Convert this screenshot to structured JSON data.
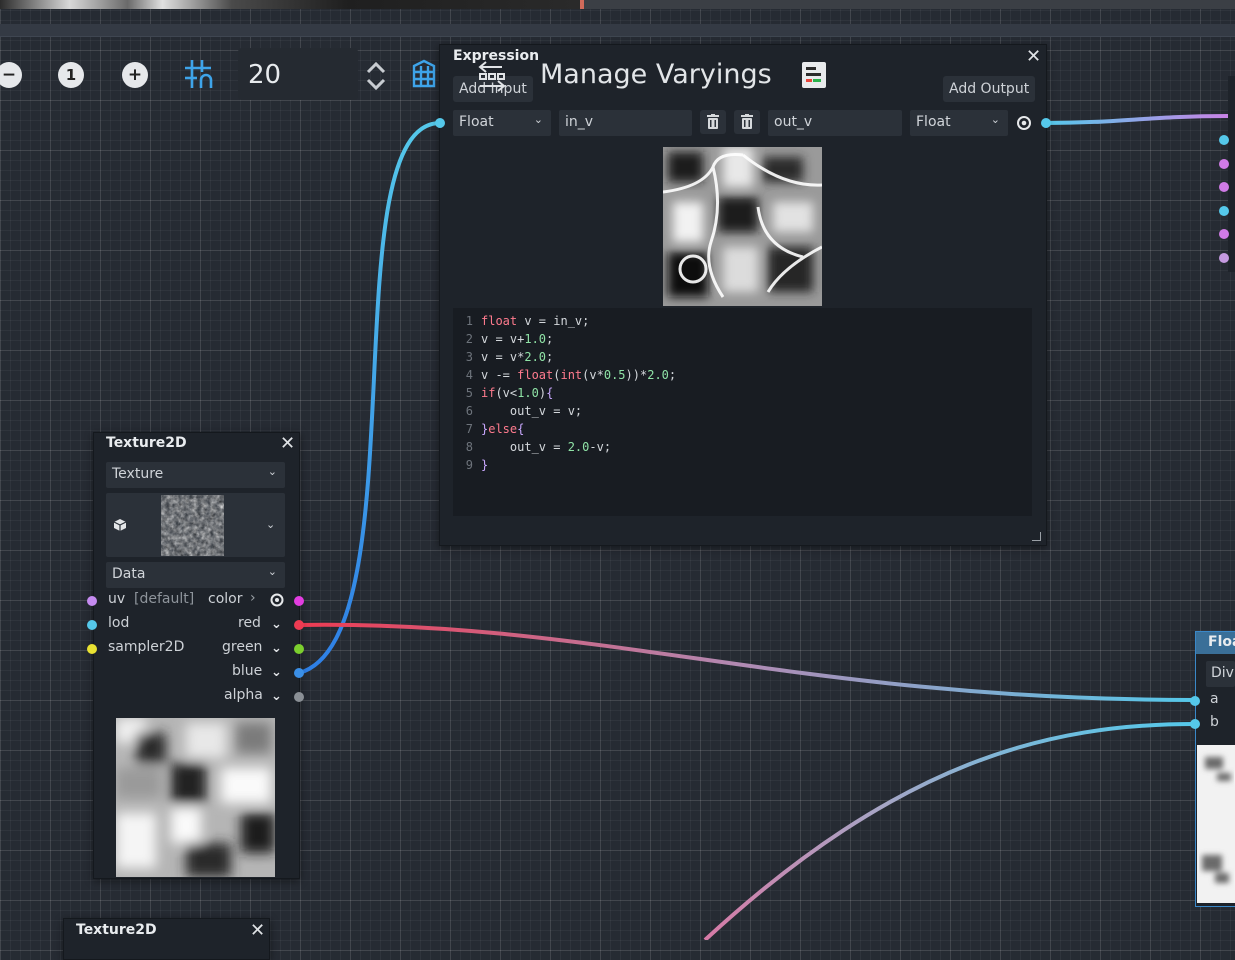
{
  "toolbar": {
    "zoom_value": "20",
    "manage_varyings_title": "Manage Varyings",
    "icons": [
      "minus-icon",
      "reset-one-icon",
      "plus-icon",
      "grid-snap-icon",
      "stepper-icon",
      "varyings-table-icon",
      "layout-icon",
      "notes-icon"
    ]
  },
  "expression_node": {
    "title": "Expression",
    "add_input_label": "Add Input",
    "add_output_label": "Add Output",
    "input_type": "Float",
    "input_name": "in_v",
    "output_name": "out_v",
    "output_type": "Float",
    "code_lines": [
      {
        "n": "1",
        "parts": [
          [
            "kw",
            "float"
          ],
          [
            "plain",
            " v = in_v;"
          ]
        ]
      },
      {
        "n": "2",
        "parts": [
          [
            "plain",
            "v = v+"
          ],
          [
            "num",
            "1.0"
          ],
          [
            "plain",
            ";"
          ]
        ]
      },
      {
        "n": "3",
        "parts": [
          [
            "plain",
            "v = v*"
          ],
          [
            "num",
            "2.0"
          ],
          [
            "plain",
            ";"
          ]
        ]
      },
      {
        "n": "4",
        "parts": [
          [
            "plain",
            "v -= "
          ],
          [
            "kw",
            "float"
          ],
          [
            "plain",
            "("
          ],
          [
            "kw",
            "int"
          ],
          [
            "plain",
            "(v*"
          ],
          [
            "num",
            "0.5"
          ],
          [
            "plain",
            "))*"
          ],
          [
            "num",
            "2.0"
          ],
          [
            "plain",
            ";"
          ]
        ]
      },
      {
        "n": "5",
        "parts": [
          [
            "kw",
            "if"
          ],
          [
            "plain",
            "(v<"
          ],
          [
            "num",
            "1.0"
          ],
          [
            "plain",
            ")"
          ],
          [
            "brace",
            "{"
          ]
        ]
      },
      {
        "n": "6",
        "parts": [
          [
            "plain",
            "    out_v = v;"
          ]
        ]
      },
      {
        "n": "7",
        "parts": [
          [
            "brace",
            "}"
          ],
          [
            "kw",
            "else"
          ],
          [
            "brace",
            "{"
          ]
        ]
      },
      {
        "n": "8",
        "parts": [
          [
            "plain",
            "    out_v = "
          ],
          [
            "num",
            "2.0"
          ],
          [
            "plain",
            "-v;"
          ]
        ]
      },
      {
        "n": "9",
        "parts": [
          [
            "brace",
            "}"
          ]
        ]
      }
    ]
  },
  "texture_node": {
    "title": "Texture2D",
    "texture_select": "Texture",
    "data_select": "Data",
    "inputs": [
      {
        "label": "uv",
        "hint": "[default]",
        "color": "#c58bf0"
      },
      {
        "label": "lod",
        "hint": "",
        "color": "#55c8ea"
      },
      {
        "label": "sampler2D",
        "hint": "",
        "color": "#e9e232"
      }
    ],
    "outputs": [
      {
        "label": "color",
        "color": "#e23de0"
      },
      {
        "label": "red",
        "color": "#ee3b52"
      },
      {
        "label": "green",
        "color": "#7ccf2e"
      },
      {
        "label": "blue",
        "color": "#3b8fe6"
      },
      {
        "label": "alpha",
        "color": "#8a8f95"
      }
    ]
  },
  "texture_node_2": {
    "title": "Texture2D"
  },
  "float_node": {
    "title": "Floa",
    "select": "Div",
    "inputs": [
      {
        "label": "a",
        "color": "#55c8ea"
      },
      {
        "label": "b",
        "color": "#55c8ea"
      }
    ]
  },
  "right_edge_ports": [
    "#55c8ea",
    "#d07be6",
    "#d07be6",
    "#55c8ea",
    "#d07be6",
    "#c59ae0"
  ]
}
